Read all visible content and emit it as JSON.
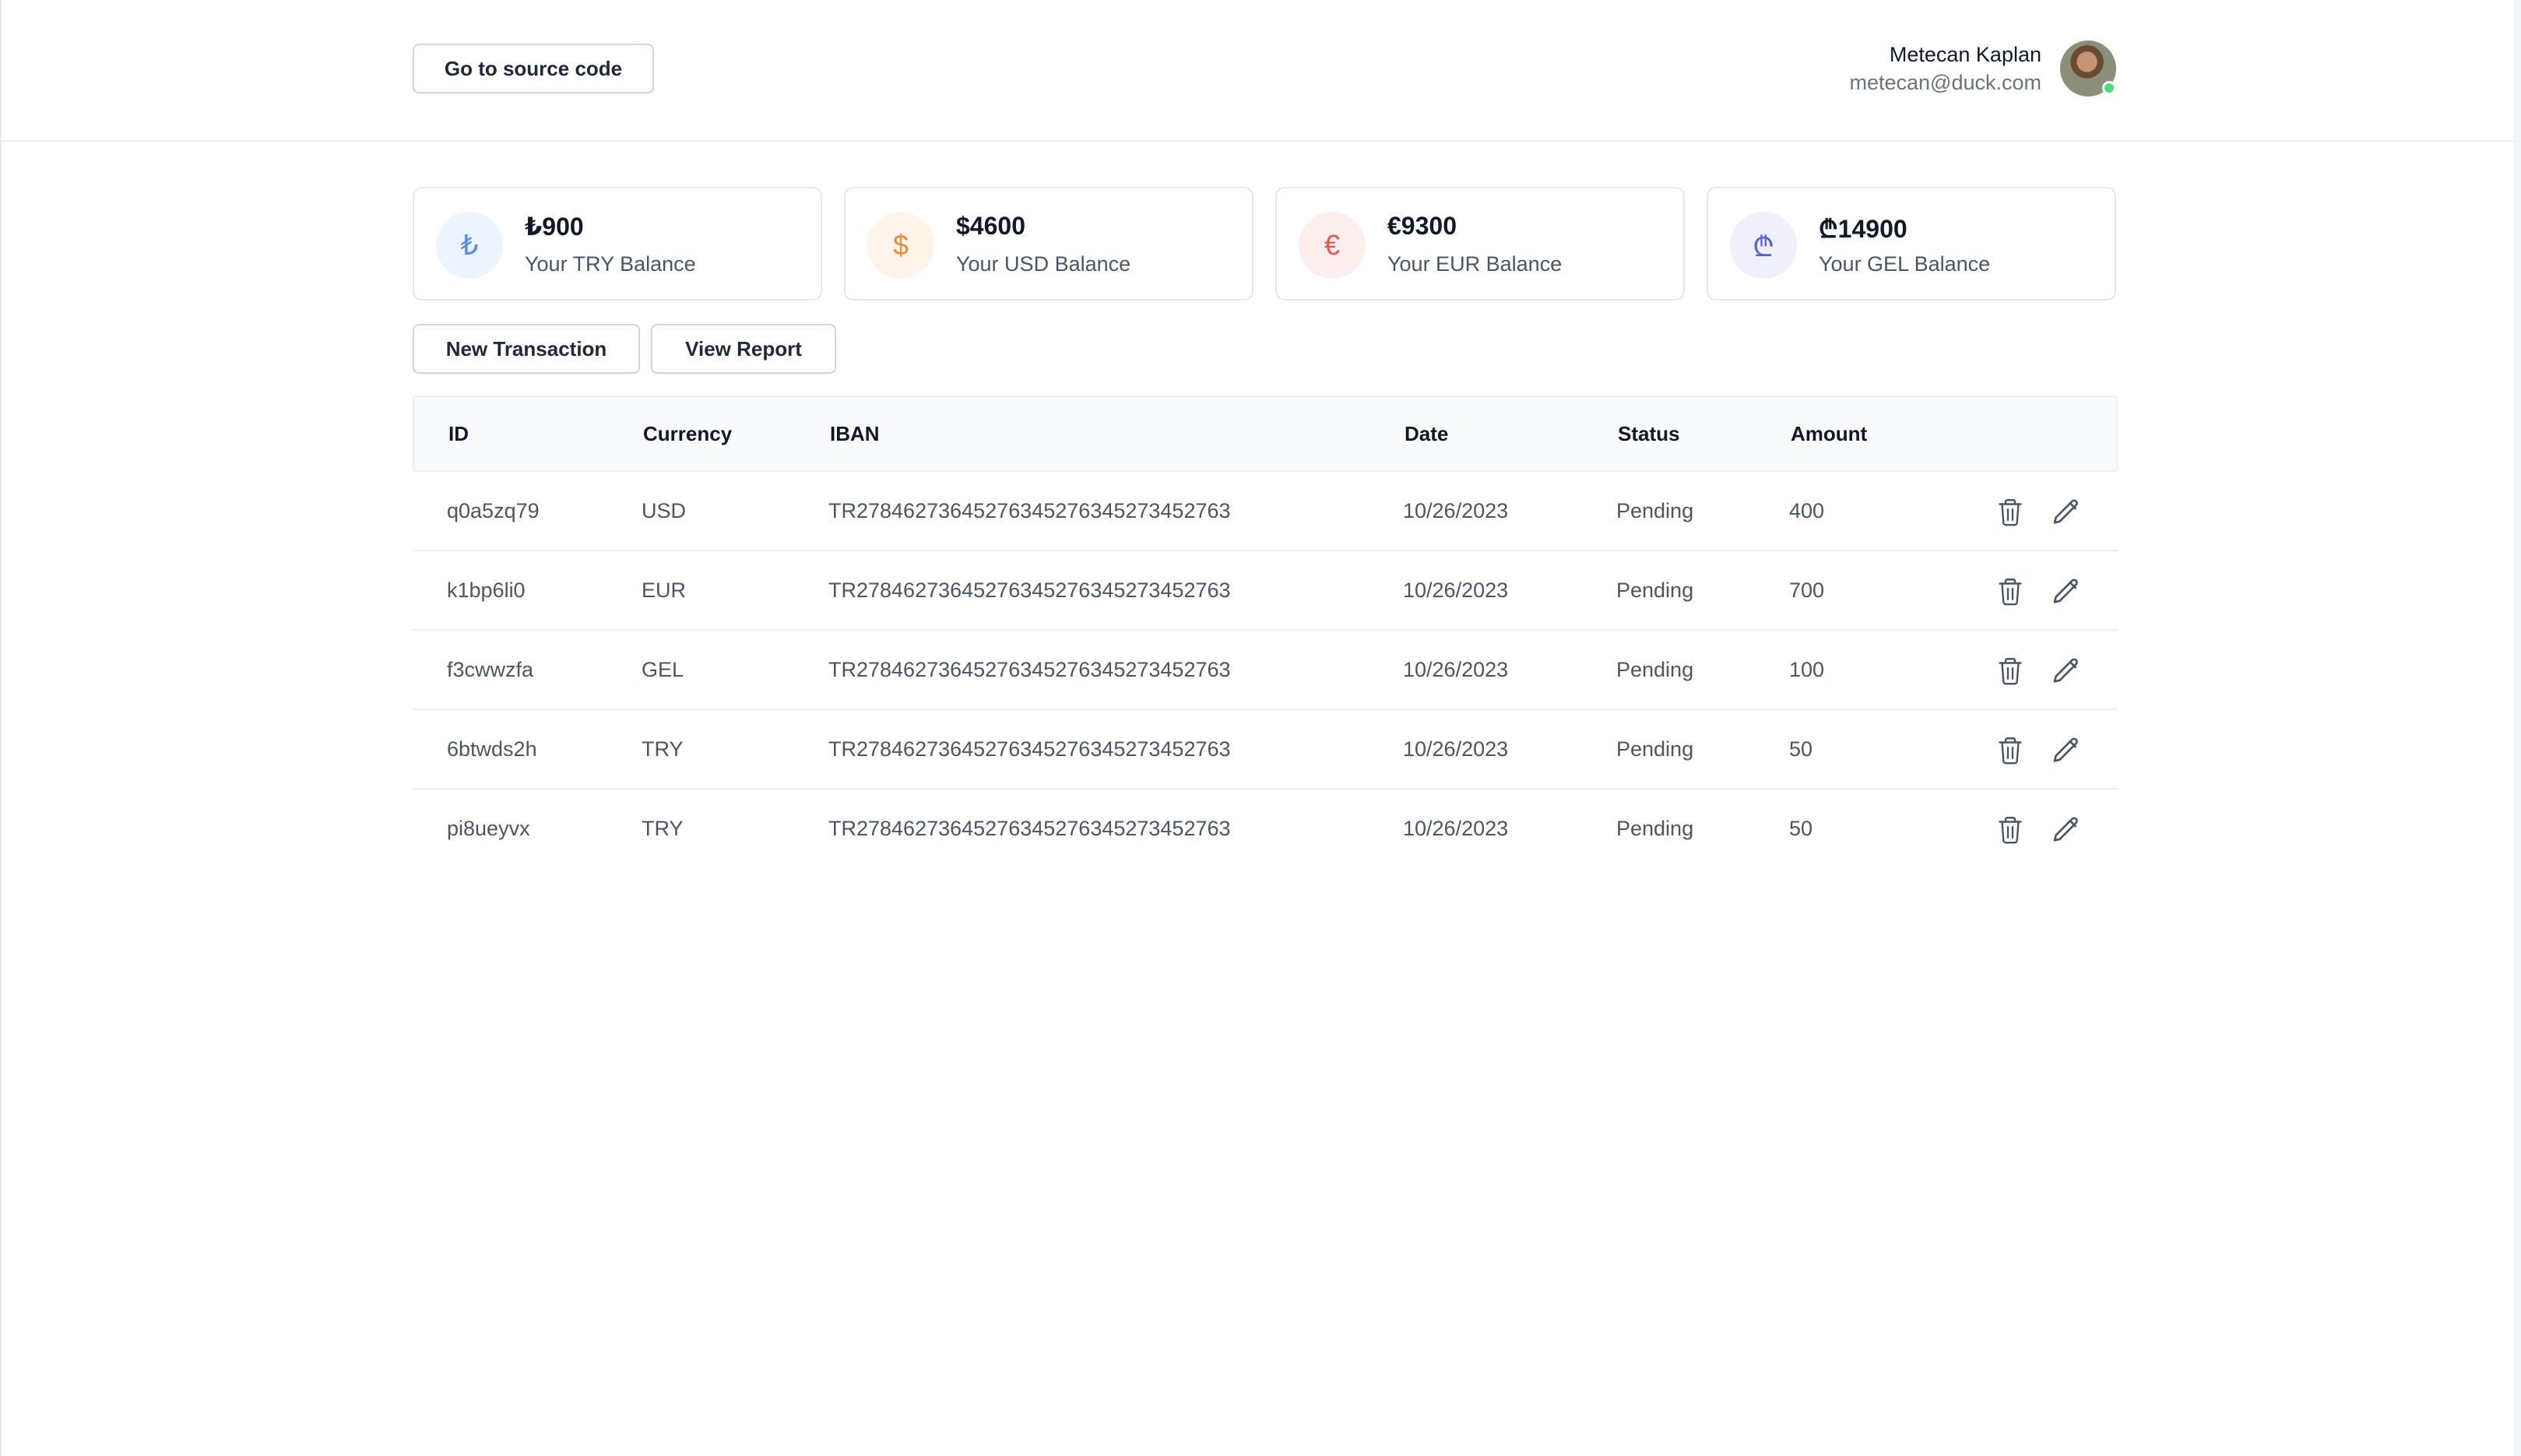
{
  "header": {
    "source_button": "Go to source code",
    "user": {
      "name": "Metecan Kaplan",
      "email": "metecan@duck.com",
      "status": "online"
    }
  },
  "balances": [
    {
      "symbol": "₺",
      "value": "₺900",
      "label": "Your TRY Balance",
      "icon_color": "#5b8def",
      "icon_bg": "#eef4fe"
    },
    {
      "symbol": "$",
      "value": "$4600",
      "label": "Your USD Balance",
      "icon_color": "#f0883e",
      "icon_bg": "#fff4ea"
    },
    {
      "symbol": "€",
      "value": "€9300",
      "label": "Your EUR Balance",
      "icon_color": "#e2574c",
      "icon_bg": "#fdeeee"
    },
    {
      "symbol": "₾",
      "value": "₾14900",
      "label": "Your GEL Balance",
      "icon_color": "#5b5fd6",
      "icon_bg": "#f0f0fd"
    }
  ],
  "actions": {
    "new_transaction": "New Transaction",
    "view_report": "View Report"
  },
  "table": {
    "columns": [
      "ID",
      "Currency",
      "IBAN",
      "Date",
      "Status",
      "Amount"
    ],
    "rows": [
      {
        "id": "q0a5zq79",
        "currency": "USD",
        "iban": "TR2784627364527634527634527345276 3",
        "date": "10/26/2023",
        "status": "Pending",
        "amount": "400"
      },
      {
        "id": "k1bp6li0",
        "currency": "EUR",
        "iban": "TR27846273645276345276345273452763",
        "date": "10/26/2023",
        "status": "Pending",
        "amount": "700"
      },
      {
        "id": "f3cwwzfa",
        "currency": "GEL",
        "iban": "TR27846273645276345276345273452763",
        "date": "10/26/2023",
        "status": "Pending",
        "amount": "100"
      },
      {
        "id": "6btwds2h",
        "currency": "TRY",
        "iban": "TR27846273645276345276345273452763",
        "date": "10/26/2023",
        "status": "Pending",
        "amount": "50"
      },
      {
        "id": "pi8ueyvx",
        "currency": "TRY",
        "iban": "TR27846273645276345276345273452763",
        "date": "10/26/2023",
        "status": "Pending",
        "amount": "50"
      }
    ],
    "row_actions": {
      "delete_icon": "trash-icon",
      "edit_icon": "pencil-icon"
    }
  }
}
